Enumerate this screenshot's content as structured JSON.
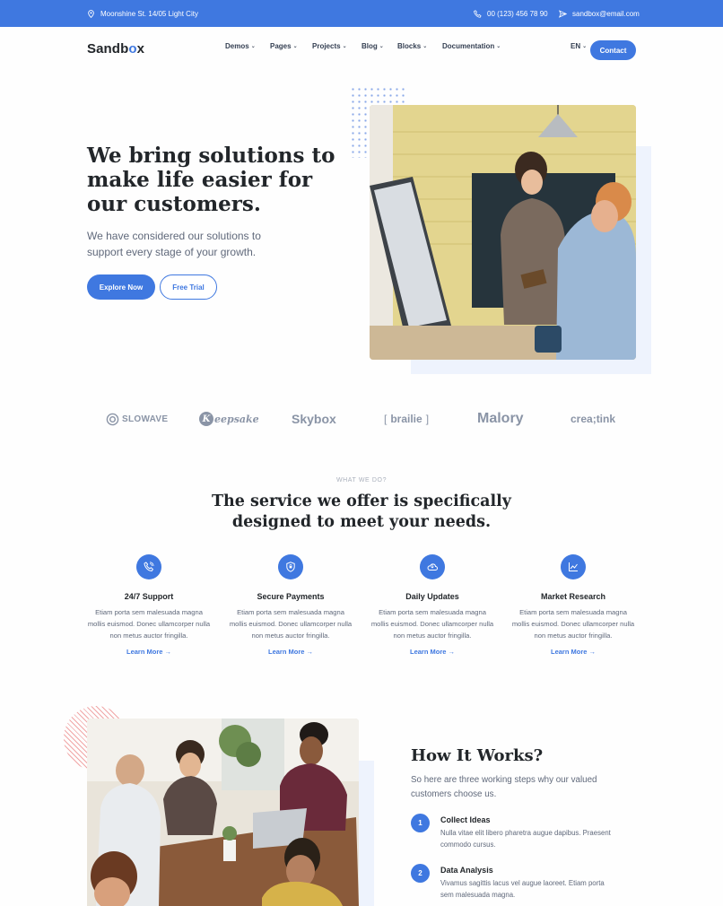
{
  "topbar": {
    "address": "Moonshine St. 14/05 Light City",
    "phone": "00 (123) 456 78 90",
    "email": "sandbox@email.com"
  },
  "nav": {
    "logo_pre": "Sandb",
    "logo_o": "o",
    "logo_post": "x",
    "items": [
      "Demos",
      "Pages",
      "Projects",
      "Blog",
      "Blocks",
      "Documentation"
    ],
    "language": "EN",
    "contact_label": "Contact"
  },
  "hero": {
    "title": "We bring solutions to make life easier for our customers.",
    "subtitle": "We have considered our solutions to support every stage of your growth.",
    "primary_button": "Explore Now",
    "secondary_button": "Free Trial"
  },
  "clients": [
    "SLOWAVE",
    "eepsake",
    "Skybox",
    "brailie",
    "Malory",
    "crea;tink"
  ],
  "services": {
    "eyebrow": "WHAT WE DO?",
    "title": "The service we offer is specifically designed to meet your needs.",
    "features": [
      {
        "icon": "phone-icon",
        "title": "24/7 Support",
        "text": "Etiam porta sem malesuada magna mollis euismod. Donec ullamcorper nulla non metus auctor fringilla.",
        "link": "Learn More"
      },
      {
        "icon": "shield-icon",
        "title": "Secure Payments",
        "text": "Etiam porta sem malesuada magna mollis euismod. Donec ullamcorper nulla non metus auctor fringilla.",
        "link": "Learn More"
      },
      {
        "icon": "cloud-icon",
        "title": "Daily Updates",
        "text": "Etiam porta sem malesuada magna mollis euismod. Donec ullamcorper nulla non metus auctor fringilla.",
        "link": "Learn More"
      },
      {
        "icon": "analytics-icon",
        "title": "Market Research",
        "text": "Etiam porta sem malesuada magna mollis euismod. Donec ullamcorper nulla non metus auctor fringilla.",
        "link": "Learn More"
      }
    ]
  },
  "how": {
    "title": "How It Works?",
    "subtitle": "So here are three working steps why our valued customers choose us.",
    "steps": [
      {
        "num": "1",
        "title": "Collect Ideas",
        "text": "Nulla vitae elit libero pharetra augue dapibus. Praesent commodo cursus."
      },
      {
        "num": "2",
        "title": "Data Analysis",
        "text": "Vivamus sagittis lacus vel augue laoreet. Etiam porta sem malesuada magna."
      }
    ]
  },
  "colors": {
    "primary": "#3f78e0",
    "heading": "#22262a",
    "body": "#60697b"
  }
}
